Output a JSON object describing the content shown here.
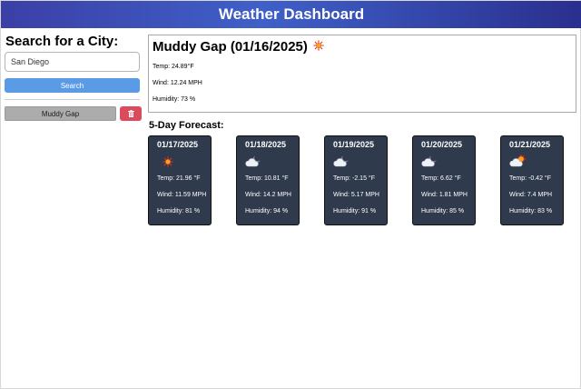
{
  "header": {
    "title": "Weather Dashboard"
  },
  "sidebar": {
    "title": "Search for a City:",
    "search_value": "San Diego",
    "search_button": "Search",
    "history": [
      {
        "label": "Muddy Gap"
      }
    ],
    "delete_icon": "trash-icon"
  },
  "current": {
    "title": "Muddy Gap (01/16/2025)",
    "icon": "sun-icon",
    "temp": "Temp: 24.89°F",
    "wind": "Wind: 12.24 MPH",
    "humidity": "Humidity: 73 %"
  },
  "forecast": {
    "title": "5-Day Forecast:",
    "days": [
      {
        "date": "01/17/2025",
        "icon": "sun-icon",
        "temp": "Temp: 21.96 °F",
        "wind": "Wind: 11.59 MPH",
        "humidity": "Humidity: 81 %"
      },
      {
        "date": "01/18/2025",
        "icon": "cloud-moon-icon",
        "temp": "Temp: 10.81 °F",
        "wind": "Wind: 14.2 MPH",
        "humidity": "Humidity: 94 %"
      },
      {
        "date": "01/19/2025",
        "icon": "cloud-moon-icon",
        "temp": "Temp: -2.15 °F",
        "wind": "Wind: 5.17 MPH",
        "humidity": "Humidity: 91 %"
      },
      {
        "date": "01/20/2025",
        "icon": "cloud-moon-icon",
        "temp": "Temp: 6.62 °F",
        "wind": "Wind: 1.81 MPH",
        "humidity": "Humidity: 85 %"
      },
      {
        "date": "01/21/2025",
        "icon": "cloud-sun-icon",
        "temp": "Temp: -0.42 °F",
        "wind": "Wind: 7.4 MPH",
        "humidity": "Humidity: 83 %"
      }
    ]
  },
  "colors": {
    "header_gradient": [
      "#3b3fa6",
      "#3f60c8",
      "#2a2f8e"
    ],
    "search_button": "#5b9be6",
    "history_button": "#acacac",
    "delete_button": "#dc4b5b",
    "card_bg": "#2f3a4d"
  }
}
